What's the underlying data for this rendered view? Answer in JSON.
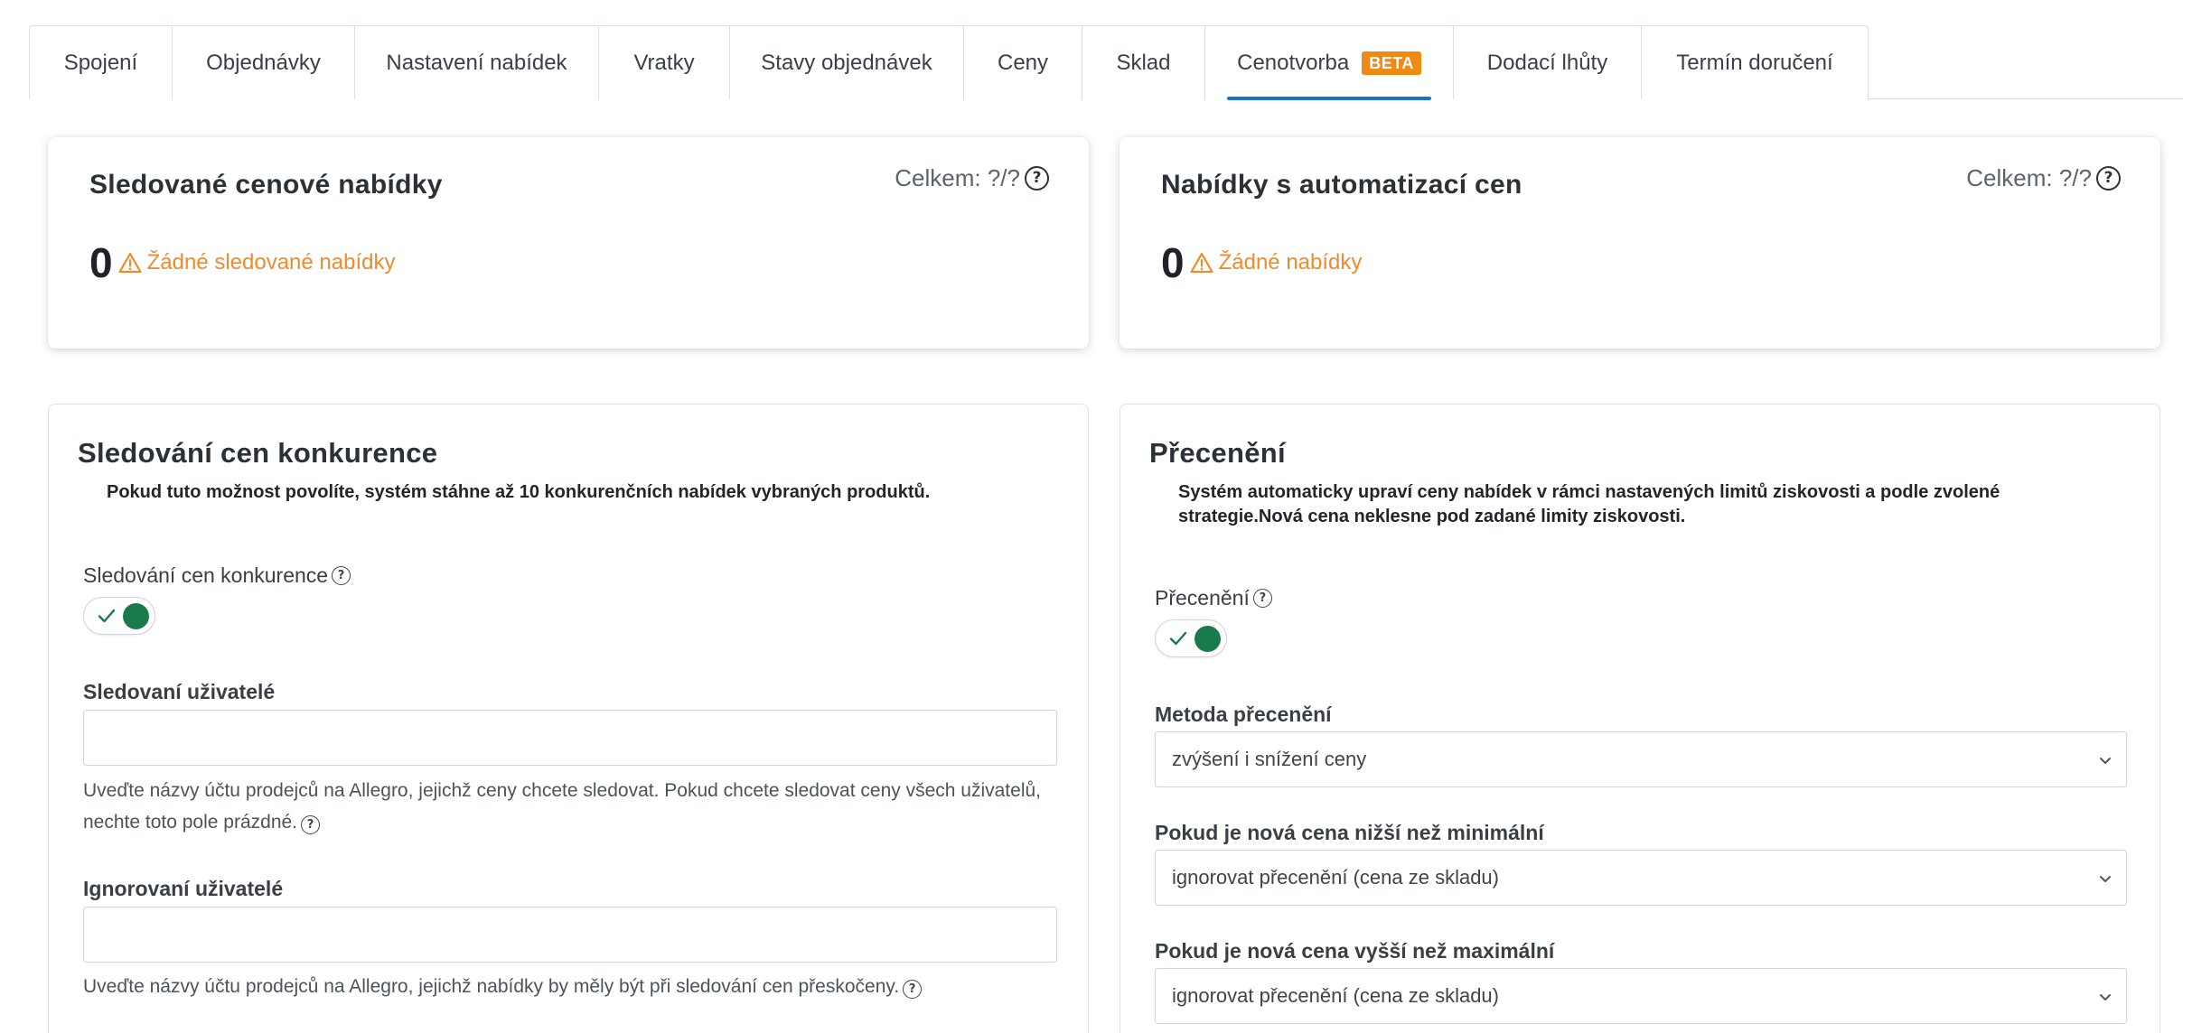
{
  "tabs": [
    {
      "label": "Spojení"
    },
    {
      "label": "Objednávky"
    },
    {
      "label": "Nastavení nabídek"
    },
    {
      "label": "Vratky"
    },
    {
      "label": "Stavy objednávek"
    },
    {
      "label": "Ceny"
    },
    {
      "label": "Sklad"
    },
    {
      "label": "Cenotvorba",
      "badge": "BETA",
      "active": true
    },
    {
      "label": "Dodací lhůty"
    },
    {
      "label": "Termín doručení"
    }
  ],
  "stats": {
    "tracked": {
      "title": "Sledované cenové nabídky",
      "total_label": "Celkem: ?/?",
      "value": "0",
      "warning": "Žádné sledované nabídky"
    },
    "automated": {
      "title": "Nabídky s automatizací cen",
      "total_label": "Celkem: ?/?",
      "value": "0",
      "warning": "Žádné nabídky"
    }
  },
  "competition": {
    "title": "Sledování cen konkurence",
    "description": "Pokud tuto možnost povolíte, systém stáhne až 10 konkurenčních nabídek vybraných produktů.",
    "toggle_label": "Sledování cen konkurence",
    "toggle_on": true,
    "tracked_users_label": "Sledovaní uživatelé",
    "tracked_users_value": "",
    "tracked_users_hint": "Uveďte názvy účtu prodejců na Allegro, jejichž ceny chcete sledovat. Pokud chcete sledovat ceny všech uživatelů, nechte toto pole prázdné.",
    "ignored_users_label": "Ignorovaní uživatelé",
    "ignored_users_value": "",
    "ignored_users_hint": "Uveďte názvy účtu prodejců na Allegro, jejichž nabídky by měly být při sledování cen přeskočeny."
  },
  "repricing": {
    "title": "Přecenění",
    "description": "Systém automaticky upraví ceny nabídek v rámci nastavených limitů ziskovosti a podle zvolené strategie.Nová cena neklesne pod zadané limity ziskovosti.",
    "toggle_label": "Přecenění",
    "toggle_on": true,
    "method_label": "Metoda přecenění",
    "method_value": "zvýšení i snížení ceny",
    "below_min_label": "Pokud je nová cena nižší než minimální",
    "below_min_value": "ignorovat přecenění (cena ze skladu)",
    "above_max_label": "Pokud je nová cena vyšší než maximální",
    "above_max_value": "ignorovat přecenění (cena ze skladu)"
  },
  "colors": {
    "accent": "#1a73c8",
    "beta_badge": "#f08a14",
    "warning": "#ef8b2c",
    "toggle_on": "#1b7a4c"
  }
}
